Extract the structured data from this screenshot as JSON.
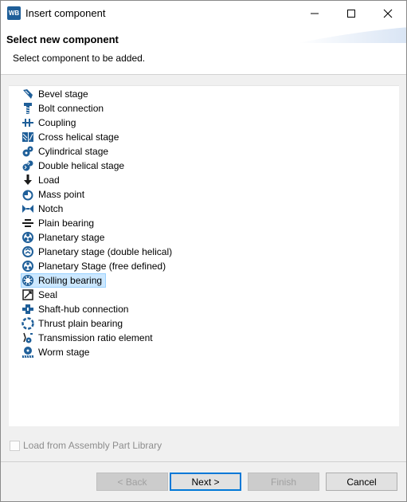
{
  "window": {
    "app_icon_text": "WB",
    "title": "Insert component",
    "minimize_glyph": "—",
    "maximize_glyph": "☐",
    "close_glyph": "✕"
  },
  "header": {
    "title": "Select new component",
    "description": "Select component to be added."
  },
  "components": [
    {
      "label": "Bevel stage",
      "icon": "bevel-gear-icon"
    },
    {
      "label": "Bolt connection",
      "icon": "bolt-icon"
    },
    {
      "label": "Coupling",
      "icon": "coupling-icon"
    },
    {
      "label": "Cross helical stage",
      "icon": "cross-helical-gear-icon"
    },
    {
      "label": "Cylindrical stage",
      "icon": "cylindrical-gear-icon"
    },
    {
      "label": "Double helical stage",
      "icon": "double-helical-gear-icon"
    },
    {
      "label": "Load",
      "icon": "load-arrow-icon"
    },
    {
      "label": "Mass point",
      "icon": "mass-point-icon"
    },
    {
      "label": "Notch",
      "icon": "notch-icon"
    },
    {
      "label": "Plain bearing",
      "icon": "plain-bearing-icon"
    },
    {
      "label": "Planetary stage",
      "icon": "planetary-gear-icon"
    },
    {
      "label": "Planetary stage (double helical)",
      "icon": "planetary-double-helical-icon"
    },
    {
      "label": "Planetary Stage (free defined)",
      "icon": "planetary-free-icon"
    },
    {
      "label": "Rolling bearing",
      "icon": "rolling-bearing-icon",
      "selected": true
    },
    {
      "label": "Seal",
      "icon": "seal-icon"
    },
    {
      "label": "Shaft-hub connection",
      "icon": "shaft-hub-icon"
    },
    {
      "label": "Thrust plain bearing",
      "icon": "thrust-bearing-icon"
    },
    {
      "label": "Transmission ratio element",
      "icon": "transmission-ratio-icon"
    },
    {
      "label": "Worm stage",
      "icon": "worm-gear-icon"
    }
  ],
  "options": {
    "load_from_library_label": "Load from Assembly Part Library",
    "load_from_library_checked": false
  },
  "buttons": {
    "back": "< Back",
    "next": "Next >",
    "finish": "Finish",
    "cancel": "Cancel"
  },
  "colors": {
    "icon_blue": "#1f5f99",
    "selection_bg": "#cce8ff",
    "selection_border": "#99d1ff",
    "default_button_border": "#0078d7"
  }
}
